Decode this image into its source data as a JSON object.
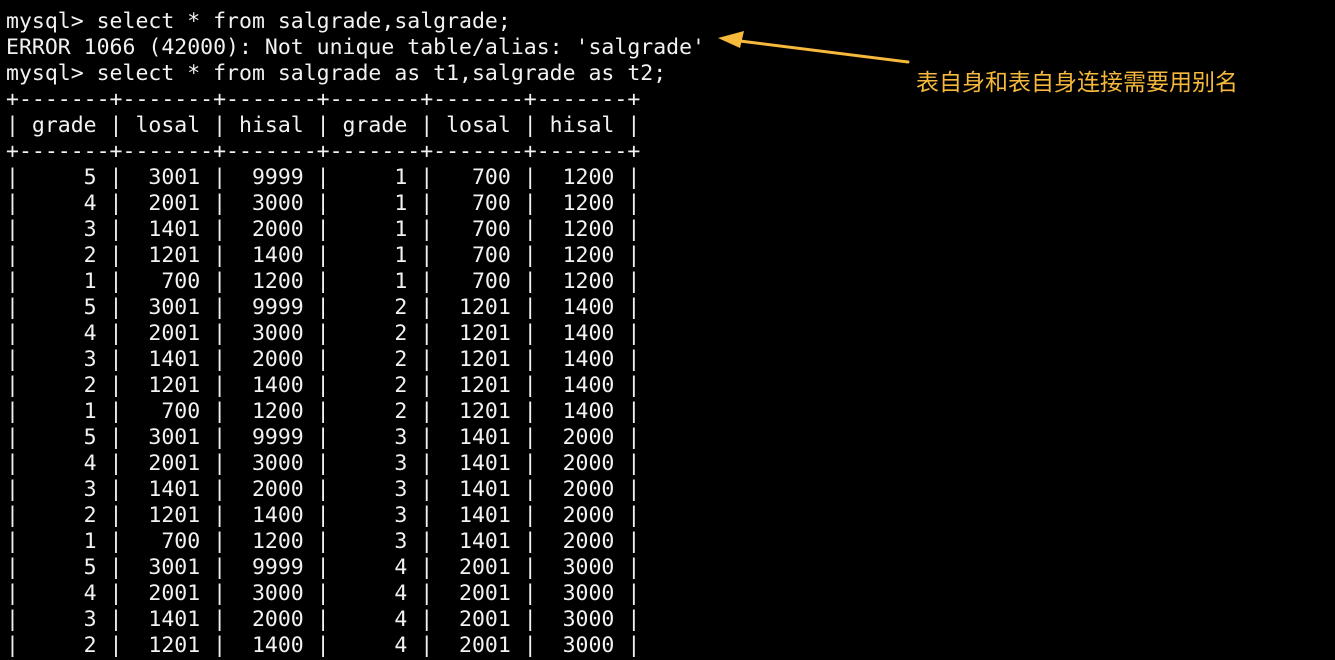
{
  "terminal": {
    "lines": [
      "mysql> select * from salgrade,salgrade;",
      "ERROR 1066 (42000): Not unique table/alias: 'salgrade'",
      "mysql> select * from salgrade as t1,salgrade as t2;",
      "+-------+-------+-------+-------+-------+-------+",
      "| grade | losal | hisal | grade | losal | hisal |",
      "+-------+-------+-------+-------+-------+-------+",
      "|     5 |  3001 |  9999 |     1 |   700 |  1200 |",
      "|     4 |  2001 |  3000 |     1 |   700 |  1200 |",
      "|     3 |  1401 |  2000 |     1 |   700 |  1200 |",
      "|     2 |  1201 |  1400 |     1 |   700 |  1200 |",
      "|     1 |   700 |  1200 |     1 |   700 |  1200 |",
      "|     5 |  3001 |  9999 |     2 |  1201 |  1400 |",
      "|     4 |  2001 |  3000 |     2 |  1201 |  1400 |",
      "|     3 |  1401 |  2000 |     2 |  1201 |  1400 |",
      "|     2 |  1201 |  1400 |     2 |  1201 |  1400 |",
      "|     1 |   700 |  1200 |     2 |  1201 |  1400 |",
      "|     5 |  3001 |  9999 |     3 |  1401 |  2000 |",
      "|     4 |  2001 |  3000 |     3 |  1401 |  2000 |",
      "|     3 |  1401 |  2000 |     3 |  1401 |  2000 |",
      "|     2 |  1201 |  1400 |     3 |  1401 |  2000 |",
      "|     1 |   700 |  1200 |     3 |  1401 |  2000 |",
      "|     5 |  3001 |  9999 |     4 |  2001 |  3000 |",
      "|     4 |  2001 |  3000 |     4 |  2001 |  3000 |",
      "|     3 |  1401 |  2000 |     4 |  2001 |  3000 |",
      "|     2 |  1201 |  1400 |     4 |  2001 |  3000 |"
    ]
  },
  "annotation": {
    "text": "表自身和表自身连接需要用别名"
  },
  "colors": {
    "background": "#000000",
    "text": "#f2f2f2",
    "annotation": "#f6b93b"
  }
}
